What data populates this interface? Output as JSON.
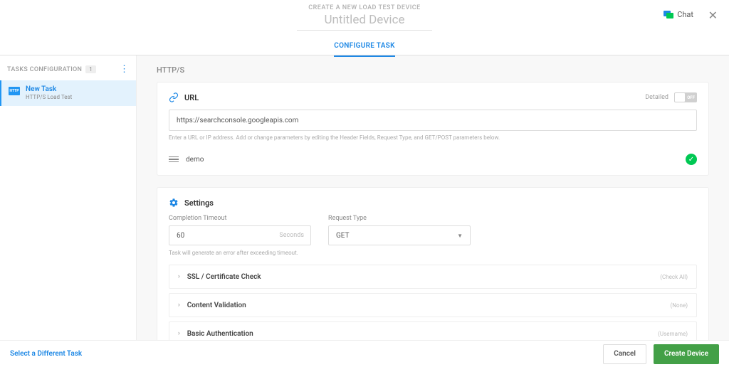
{
  "header": {
    "eyebrow": "CREATE A NEW LOAD TEST DEVICE",
    "device_name_placeholder": "Untitled Device",
    "tab_label": "CONFIGURE TASK",
    "chat_label": "Chat"
  },
  "sidebar": {
    "title": "TASKS CONFIGURATION",
    "count": "1",
    "task_name": "New Task",
    "task_type": "HTTP/S Load Test",
    "task_icon_text": "HTTP"
  },
  "main": {
    "section_label": "HTTP/S",
    "url_card": {
      "title": "URL",
      "detailed_label": "Detailed",
      "toggle_text": "OFF",
      "url_value": "https://searchconsole.googleapis.com",
      "hint": "Enter a URL or IP address. Add or change parameters by editing the Header Fields, Request Type, and GET/POST parameters below.",
      "demo_label": "demo"
    },
    "settings_card": {
      "title": "Settings",
      "timeout_label": "Completion Timeout",
      "timeout_value": "60",
      "timeout_suffix": "Seconds",
      "request_type_label": "Request Type",
      "request_type_value": "GET",
      "timeout_hint": "Task will generate an error after exceeding timeout.",
      "accordions": [
        {
          "title": "SSL / Certificate Check",
          "status": "(Check All)"
        },
        {
          "title": "Content Validation",
          "status": "(None)"
        },
        {
          "title": "Basic Authentication",
          "status": "(Username)"
        }
      ]
    }
  },
  "footer": {
    "select_link": "Select a Different Task",
    "cancel": "Cancel",
    "create": "Create Device"
  }
}
